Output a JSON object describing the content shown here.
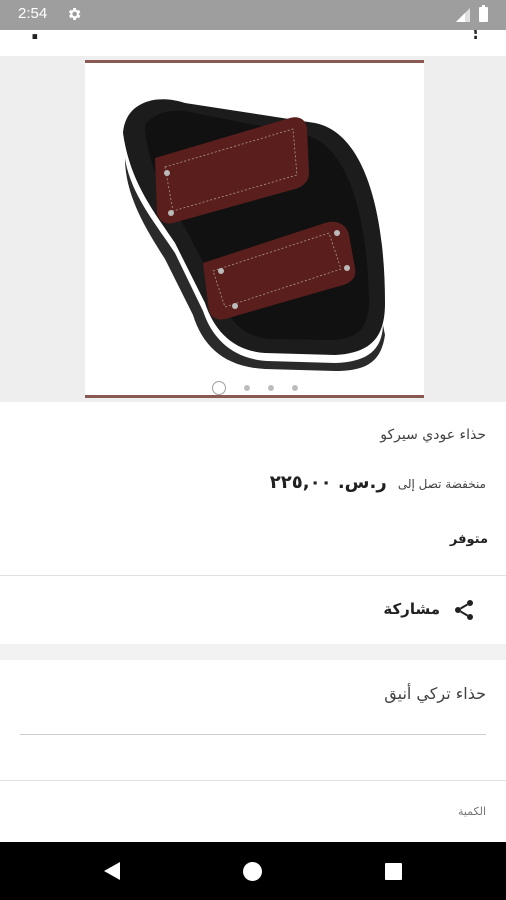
{
  "status_bar": {
    "time": "2:54"
  },
  "top_bar": {
    "title_fragment": "؛",
    "action_fragment": "؟"
  },
  "gallery": {
    "image_label": "sandal",
    "page_count": 4,
    "active_page": 1
  },
  "product": {
    "name": "حذاء عودي سيركو",
    "price_prefix": "منخفضة تصل إلى",
    "price": "ر.س. ٢٢٥,٠٠",
    "availability": "متوفر"
  },
  "share": {
    "label": "مشاركة"
  },
  "description": {
    "title": "حذاء تركي أنيق"
  },
  "quantity": {
    "label": "الكمية"
  },
  "colors": {
    "status_bar": "#9e9e9e",
    "frame_accent": "#8a5a52",
    "leather": "#5a1f1c"
  }
}
